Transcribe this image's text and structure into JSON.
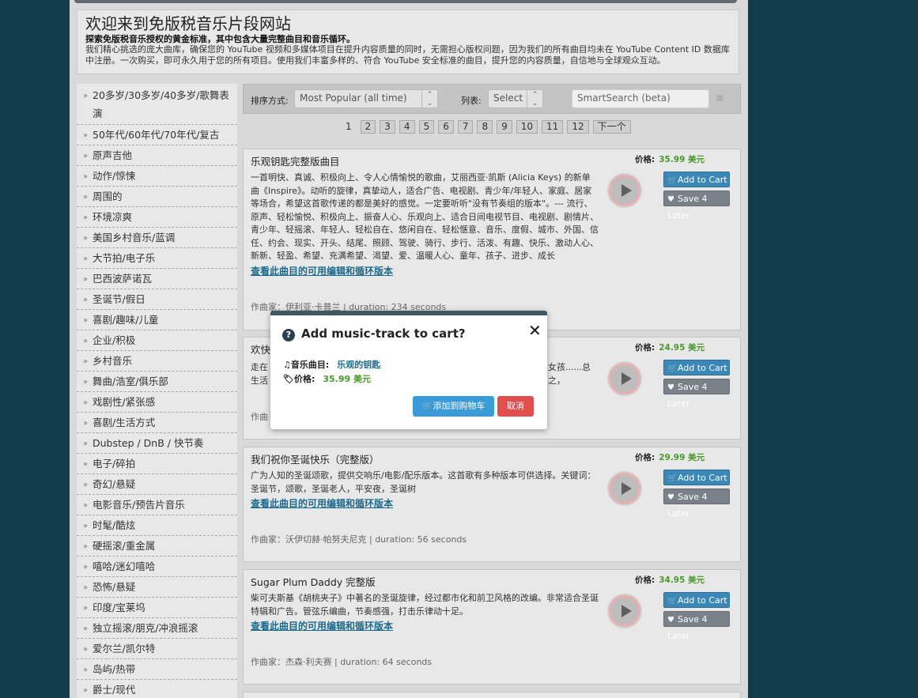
{
  "header": {
    "title": "欢迎来到免版税音乐片段网站",
    "subtitle": "探索免版税音乐授权的黄金标准，其中包含大量完整曲目和音乐循环。",
    "description": "我们精心挑选的庞大曲库，确保您的 YouTube 视频和多媒体项目在提升内容质量的同时，无需担心版权问题，因为我们的所有曲目均未在 YouTube Content ID 数据库中注册。一次购买，即可永久用于您的所有项目。使用我们丰富多样的、符合 YouTube 安全标准的曲目，提升您的内容质量，自信地与全球观众互动。"
  },
  "sidebar": {
    "items": [
      {
        "label": "20多岁/30多岁/40多岁/歌舞表演"
      },
      {
        "label": "50年代/60年代/70年代/复古"
      },
      {
        "label": "原声吉他"
      },
      {
        "label": "动作/惊悚"
      },
      {
        "label": "周围的"
      },
      {
        "label": "环境凉爽"
      },
      {
        "label": "美国乡村音乐/蓝调"
      },
      {
        "label": "大节拍/电子乐"
      },
      {
        "label": "巴西波萨诺瓦"
      },
      {
        "label": "圣诞节/假日"
      },
      {
        "label": "喜剧/趣味/儿童"
      },
      {
        "label": "企业/积极"
      },
      {
        "label": "乡村音乐"
      },
      {
        "label": "舞曲/浩室/俱乐部"
      },
      {
        "label": "戏剧性/紧张感"
      },
      {
        "label": "喜剧/生活方式"
      },
      {
        "label": "Dubstep / DnB / 快节奏"
      },
      {
        "label": "电子/碎拍"
      },
      {
        "label": "奇幻/悬疑"
      },
      {
        "label": "电影音乐/预告片音乐"
      },
      {
        "label": "时髦/酷炫"
      },
      {
        "label": "硬摇滚/重金属"
      },
      {
        "label": "嘻哈/迷幻嘻哈"
      },
      {
        "label": "恐怖/悬疑"
      },
      {
        "label": "印度/宝莱坞"
      },
      {
        "label": "独立摇滚/朋克/冲浪摇滚"
      },
      {
        "label": "爱尔兰/凯尔特"
      },
      {
        "label": "岛屿/热带"
      },
      {
        "label": "爵士/现代"
      }
    ]
  },
  "toolbar": {
    "sort_label": "排序方式:",
    "sort_value": "Most Popular (all time)",
    "list_label": "列表:",
    "list_value": "Select",
    "search_placeholder": "SmartSearch (beta)"
  },
  "pager": {
    "pages": [
      "1",
      "2",
      "3",
      "4",
      "5",
      "6",
      "7",
      "8",
      "9",
      "10",
      "11",
      "12"
    ],
    "next": "下一个"
  },
  "tracks": [
    {
      "title": "乐观钥匙完整版曲目",
      "desc": "一首明快、真诚、积极向上、令人心情愉悦的歌曲，艾丽西亚·凯斯 (Alicia Keys) 的新单曲《Inspire》。动听的旋律，真挚动人，适合广告、电视剧、青少年/年轻人、家庭、居家等场合，希望这首歌传递的都是美好的感觉。一定要听听\"没有节奏组的版本\"。--- 流行、原声、轻松愉悦、积极向上、振奋人心、乐观向上、适合日间电视节目、电视剧、剧情片、青少年、轻摇滚、年轻人、轻松自在、悠闲自在、轻松惬意、音乐、度假、城市、外国、信任、约会、现实、开头、结尾、照顾、驾驶、骑行、步行、活泼、有趣、快乐、激动人心、新新、轻盈、希望、充满希望、渴望、爱、温暖人心、童年、孩子、进步、成长",
      "link": "查看此曲目的可用编辑和循环版本",
      "meta": "作曲家：伊利亚·卡普兰 | duration: 234 seconds",
      "price_label": "价格:",
      "price": "35.99 美元",
      "cart": "Add to Cart",
      "later": "Save 4 Later"
    },
    {
      "title": "欢快",
      "desc": "走在",
      "desc_tail": "女孩......总之，",
      "desc2": "生活",
      "meta": "作曲",
      "price_label": "价格:",
      "price": "24.95 美元",
      "cart": "Add to Cart",
      "later": "Save 4 Later"
    },
    {
      "title": "我们祝你圣诞快乐（完整版）",
      "desc": "广为人知的圣诞颂歌，提供交响乐/电影/配乐版本。这首歌有多种版本可供选择。关键词：圣诞节，颂歌，圣诞老人，平安夜，圣诞树",
      "link": "查看此曲目的可用编辑和循环版本",
      "meta": "作曲家：沃伊切赫·帕努夫尼克 | duration: 56 seconds",
      "price_label": "价格:",
      "price": "29.99 美元",
      "cart": "Add to Cart",
      "later": "Save 4 Later"
    },
    {
      "title": "Sugar Plum Daddy 完整版",
      "desc": "柴可夫斯基《胡桃夹子》中著名的圣诞旋律，经过都市化和前卫风格的改编。非常适合圣诞特辑和广告。管弦乐编曲，节奏感强，打击乐律动十足。",
      "link": "查看此曲目的可用编辑和循环版本",
      "meta": "作曲家：杰森·利夫赛 | duration: 64 seconds",
      "price_label": "价格:",
      "price": "34.95 美元",
      "cart": "Add to Cart",
      "later": "Save 4 Later"
    }
  ],
  "modal": {
    "title": "Add music-track to cart?",
    "track_label": "音乐曲目:",
    "track_value": "乐观的钥匙",
    "price_label": "价格:",
    "price_value": "35.99 美元",
    "add_label": "添加到购物车",
    "cancel_label": "取消"
  },
  "colors": {
    "background": "#123c4a",
    "accent_blue": "#3a87b8",
    "price_green": "#4a9a2a",
    "cancel_red": "#e04e4e"
  }
}
